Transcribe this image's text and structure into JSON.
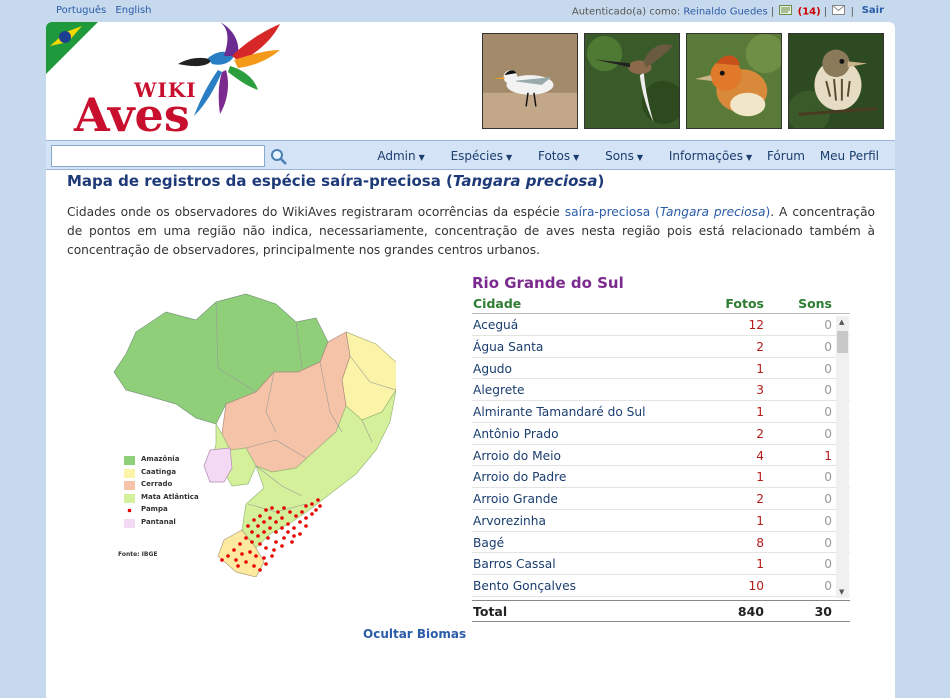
{
  "topbar": {
    "lang_pt": "Português",
    "lang_en": "English",
    "auth_label": "Autenticado(a) como:",
    "username": "Reinaldo Guedes",
    "messages_count": "(14)",
    "separator": "|",
    "logout": "Sair"
  },
  "logo": {
    "wiki": "WIKI",
    "aves": "Aves"
  },
  "nav": {
    "search_placeholder": "",
    "items": [
      "Admin",
      "Espécies",
      "Fotos",
      "Sons",
      "Informações",
      "Fórum",
      "Meu Perfil"
    ]
  },
  "page": {
    "title_prefix": "Mapa de registros da espécie saíra-preciosa (",
    "title_sci": "Tangara preciosa",
    "title_suffix": ")",
    "intro_1": "Cidades onde os observadores do WikiAves registraram ocorrências da espécie ",
    "intro_link": "saíra-preciosa (",
    "intro_link_sci": "Tangara preciosa",
    "intro_link_end": ")",
    "intro_2": ". A concentração de pontos em uma região não indica, necessariamente, concentração de aves nesta região pois está relacionado também à concentração de observadores, principalmente nos grandes centros urbanos.",
    "hide_biomes": "Ocultar Biomas"
  },
  "map": {
    "legend": [
      {
        "label": "Amazônia",
        "color": "#8fcf7a"
      },
      {
        "label": "Caatinga",
        "color": "#fbf4a8"
      },
      {
        "label": "Cerrado",
        "color": "#f5c4a8"
      },
      {
        "label": "Mata Atlântica",
        "color": "#d4f09a"
      },
      {
        "label": "Pampa",
        "color": "#e60000"
      },
      {
        "label": "Pantanal",
        "color": "#f4d9f4"
      }
    ],
    "source": "Fonte: IBGE"
  },
  "table": {
    "region": "Rio Grande do Sul",
    "headers": {
      "city": "Cidade",
      "photos": "Fotos",
      "sounds": "Sons"
    },
    "rows": [
      {
        "city": "Aceguá",
        "photos": "12",
        "sounds": "0"
      },
      {
        "city": "Água Santa",
        "photos": "2",
        "sounds": "0"
      },
      {
        "city": "Agudo",
        "photos": "1",
        "sounds": "0"
      },
      {
        "city": "Alegrete",
        "photos": "3",
        "sounds": "0"
      },
      {
        "city": "Almirante Tamandaré do Sul",
        "photos": "1",
        "sounds": "0"
      },
      {
        "city": "Antônio Prado",
        "photos": "2",
        "sounds": "0"
      },
      {
        "city": "Arroio do Meio",
        "photos": "4",
        "sounds": "1"
      },
      {
        "city": "Arroio do Padre",
        "photos": "1",
        "sounds": "0"
      },
      {
        "city": "Arroio Grande",
        "photos": "2",
        "sounds": "0"
      },
      {
        "city": "Arvorezinha",
        "photos": "1",
        "sounds": "0"
      },
      {
        "city": "Bagé",
        "photos": "8",
        "sounds": "0"
      },
      {
        "city": "Barros Cassal",
        "photos": "1",
        "sounds": "0"
      },
      {
        "city": "Bento Gonçalves",
        "photos": "10",
        "sounds": "0"
      }
    ],
    "total": {
      "label": "Total",
      "photos": "840",
      "sounds": "30"
    }
  }
}
